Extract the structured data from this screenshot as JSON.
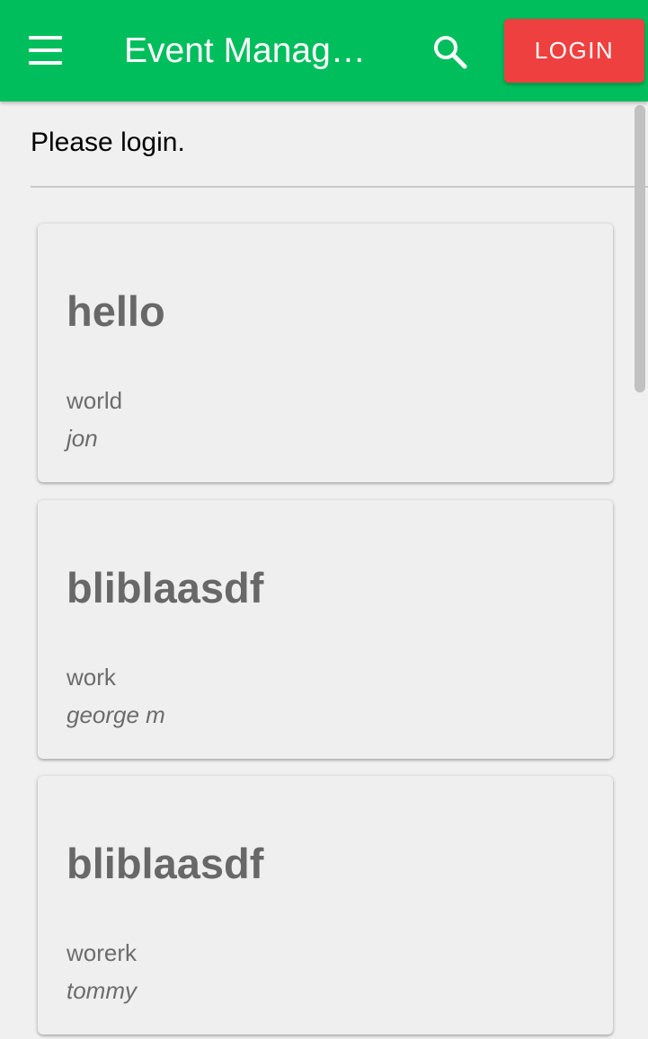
{
  "appbar": {
    "title": "Event Management",
    "login_label": "LOGIN",
    "menu_icon": "hamburger-menu-icon",
    "search_icon": "search-icon",
    "colors": {
      "bar": "#00be5c",
      "login": "#ef4040"
    }
  },
  "message": "Please login.",
  "events": [
    {
      "title": "hello",
      "description": "world",
      "author": "jon"
    },
    {
      "title": "bliblaasdf",
      "description": "work",
      "author": "george m"
    },
    {
      "title": "bliblaasdf",
      "description": "worerk",
      "author": "tommy"
    }
  ]
}
